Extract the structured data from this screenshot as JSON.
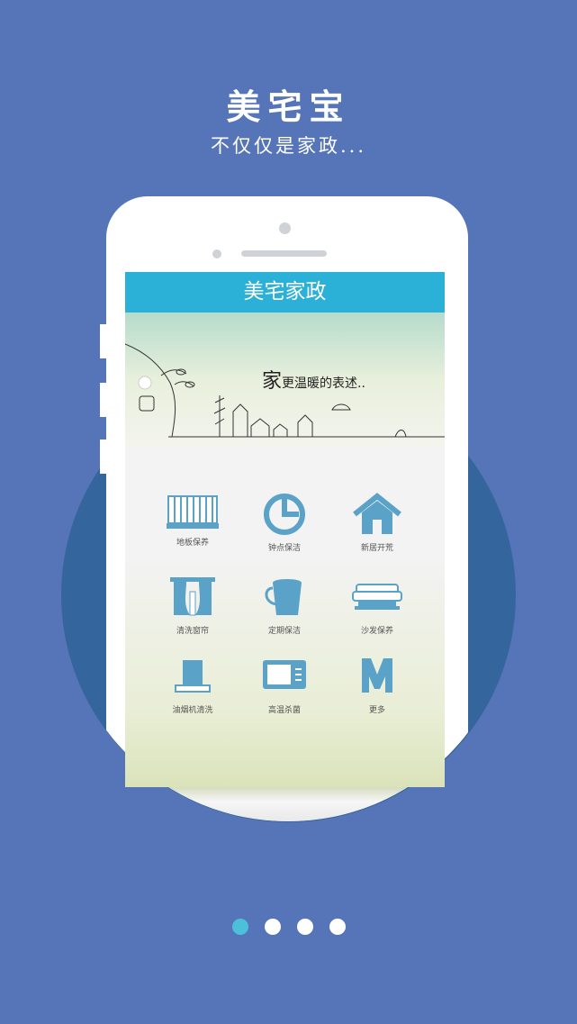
{
  "hero": {
    "title": "美宅宝",
    "subtitle": "不仅仅是家政..."
  },
  "app": {
    "title": "美宅家政",
    "banner": {
      "text_big": "家",
      "text_rest": "更温暖的表述.."
    },
    "services": [
      {
        "label": "地板保养",
        "icon": "floor-icon"
      },
      {
        "label": "钟点保洁",
        "icon": "clock-pie-icon"
      },
      {
        "label": "新居开荒",
        "icon": "house-icon"
      },
      {
        "label": "清洗窗帘",
        "icon": "curtain-icon"
      },
      {
        "label": "定期保洁",
        "icon": "bucket-icon"
      },
      {
        "label": "沙发保养",
        "icon": "sofa-icon"
      },
      {
        "label": "油烟机清洗",
        "icon": "range-hood-icon"
      },
      {
        "label": "高温杀菌",
        "icon": "microwave-icon"
      },
      {
        "label": "更多",
        "icon": "more-m-icon"
      }
    ]
  },
  "pager": {
    "count": 4,
    "active": 0
  },
  "colors": {
    "background": "#5575b8",
    "circle": "#34659c",
    "appbar": "#2bb1d8",
    "icon": "#5ba2c8",
    "active_dot": "#4cc0d8"
  }
}
